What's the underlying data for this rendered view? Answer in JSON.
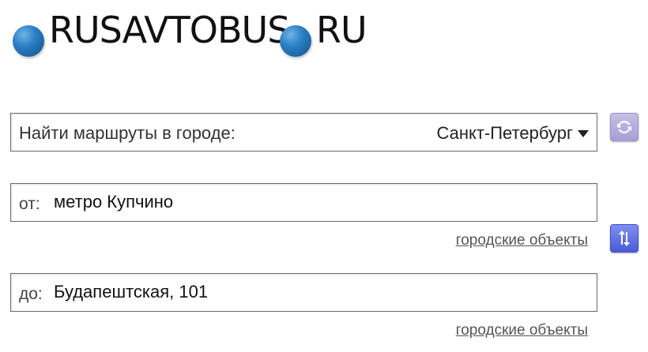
{
  "logo": {
    "part1": "RUSAVTOBUS",
    "part2": "RU",
    "dot_color": "#2a7fc4"
  },
  "city": {
    "label": "Найти маршруты в городе:",
    "selected": "Санкт-Петербург"
  },
  "from": {
    "prefix": "от:",
    "value": "метро Купчино",
    "link": "городские объекты"
  },
  "to": {
    "prefix": "до:",
    "value": "Будапештская, 101",
    "link": "городские объекты"
  },
  "icons": {
    "refresh": "refresh-icon",
    "swap": "swap-arrows-icon"
  }
}
